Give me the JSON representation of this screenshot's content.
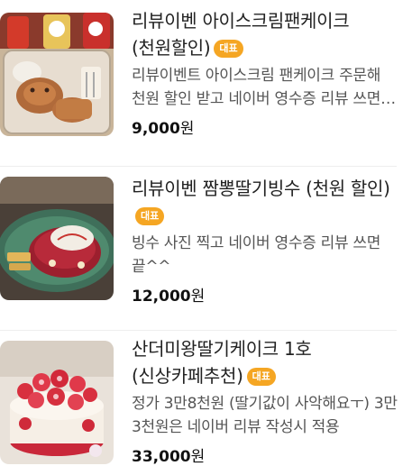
{
  "menu": {
    "items": [
      {
        "title": "리뷰이벤 아이스크림팬케이크(천원할인)",
        "badge": "대표",
        "description": "리뷰이벤트 아이스크림 팬케이크 주문해 천원 할인 받고 네이버 영수증 리뷰 쓰면 끝",
        "price": "9,000",
        "currency": "원",
        "image_icon": "pancake-photo"
      },
      {
        "title": "리뷰이벤 짬뽕딸기빙수 (천원 할인)",
        "badge": "대표",
        "description": "빙수 사진 찍고 네이버 영수증 리뷰 쓰면 끝^^",
        "price": "12,000",
        "currency": "원",
        "image_icon": "strawberry-bingsu-photo"
      },
      {
        "title": "산더미왕딸기케이크 1호(신상카페추천)",
        "badge": "대표",
        "description": "정가 3만8천원 (딸기값이 사악해요ㅜ) 3만3천원은 네이버 리뷰 작성시 적용",
        "price": "33,000",
        "currency": "원",
        "image_icon": "strawberry-cake-photo"
      }
    ]
  }
}
